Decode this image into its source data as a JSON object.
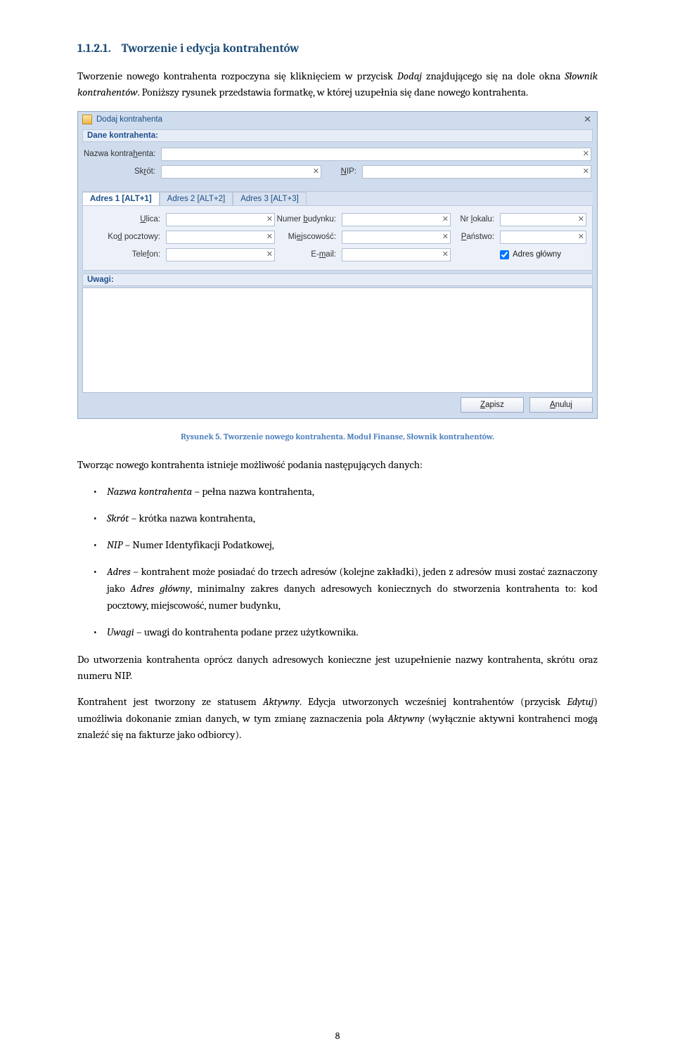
{
  "heading_num": "1.1.2.1.",
  "heading_text": "Tworzenie i edycja kontrahentów",
  "para1_a": "Tworzenie nowego kontrahenta rozpoczyna się kliknięciem w przycisk ",
  "para1_i": "Dodaj",
  "para1_b": " znajdującego się na dole okna ",
  "para1_i2": "Słownik kontrahentów",
  "para1_c": ". Poniższy rysunek przedstawia formatkę, w której uzupełnia się dane nowego kontrahenta.",
  "app": {
    "title": "Dodaj kontrahenta",
    "section_dane": "Dane kontrahenta:",
    "lbl_nazwa": "Nazwa kontrahenta:",
    "lbl_skrot": "Skrót:",
    "lbl_nip": "NIP:",
    "tabs": {
      "t1": "Adres 1 [ALT+1]",
      "t2": "Adres 2 [ALT+2]",
      "t3": "Adres 3 [ALT+3]"
    },
    "lbl_ulica": "Ulica:",
    "lbl_numerb": "Numer budynku:",
    "lbl_nrlok": "Nr lokalu:",
    "lbl_kod": "Kod pocztowy:",
    "lbl_miejsc": "Miejscowość:",
    "lbl_panstwo": "Państwo:",
    "lbl_tel": "Telefon:",
    "lbl_email": "E-mail:",
    "chk_adres": "Adres główny",
    "section_uwagi": "Uwagi:",
    "btn_zapisz": "Zapisz",
    "btn_anuluj": "Anuluj"
  },
  "caption": "Rysunek 5. Tworzenie nowego kontrahenta. Moduł Finanse, Słownik kontrahentów.",
  "para2": "Tworząc nowego kontrahenta istnieje możliwość podania następujących danych:",
  "li1_i": "Nazwa kontrahenta",
  "li1_t": " – pełna nazwa kontrahenta,",
  "li2_i": "Skrót",
  "li2_t": " – krótka nazwa kontrahenta,",
  "li3_i": "NIP",
  "li3_t": " – Numer Identyfikacji Podatkowej,",
  "li4_i": "Adres",
  "li4_t1": " – kontrahent może posiadać do trzech adresów (kolejne zakładki), jeden z adresów musi zostać zaznaczony jako ",
  "li4_i2": "Adres główny",
  "li4_t2": ", minimalny zakres danych adresowych koniecznych do stworzenia kontrahenta to: kod pocztowy, miejscowość, numer budynku,",
  "li5_i": "Uwagi",
  "li5_t": " – uwagi do kontrahenta podane przez użytkownika.",
  "para3": "Do utworzenia kontrahenta oprócz danych adresowych konieczne jest uzupełnienie nazwy kontrahenta, skrótu oraz numeru NIP.",
  "para4_a": "Kontrahent jest tworzony ze statusem ",
  "para4_i1": "Aktywny",
  "para4_b": ". Edycja utworzonych wcześniej kontrahentów (przycisk ",
  "para4_i2": "Edytuj",
  "para4_c": ") umożliwia dokonanie zmian danych, w tym zmianę zaznaczenia pola ",
  "para4_i3": "Aktywny",
  "para4_d": " (wyłącznie aktywni kontrahenci mogą znaleźć się na fakturze jako odbiorcy).",
  "pagenum": "8"
}
